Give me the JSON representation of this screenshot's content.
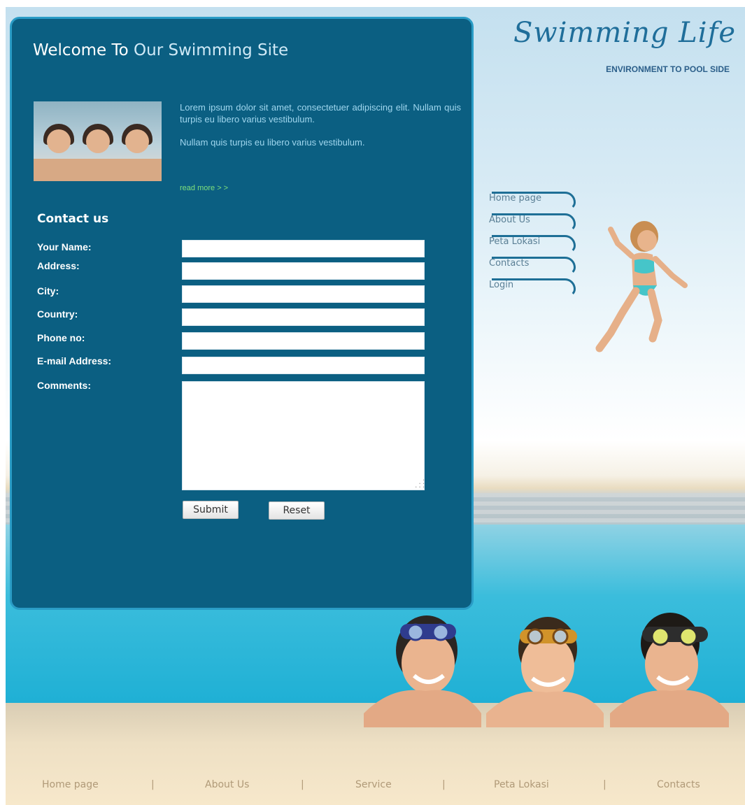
{
  "site": {
    "welcome_part1": "Welcome To ",
    "welcome_part2": "Our Swimming Site",
    "logo": "Swimming Life",
    "tagline": "ENVIRONMENT TO POOL SIDE"
  },
  "intro": {
    "paragraph1": "Lorem ipsum dolor sit amet, consectetuer adipiscing elit. Nullam quis turpis eu libero varius vestibulum.",
    "paragraph2": "Nullam quis turpis eu libero varius vestibulum.",
    "read_more": "read more > >"
  },
  "contact": {
    "title": "Contact us",
    "fields": {
      "name": {
        "label": "Your Name:",
        "value": ""
      },
      "address": {
        "label": "Address:",
        "value": ""
      },
      "city": {
        "label": "City:",
        "value": ""
      },
      "country": {
        "label": "Country:",
        "value": ""
      },
      "phone": {
        "label": "Phone no:",
        "value": ""
      },
      "email": {
        "label": "E-mail Address:",
        "value": ""
      },
      "comments": {
        "label": "Comments:",
        "value": ""
      }
    },
    "submit_label": "Submit",
    "reset_label": "Reset"
  },
  "side_nav": [
    "Home page",
    "About Us",
    "Peta Lokasi",
    "Contacts",
    "Login"
  ],
  "footer_nav": {
    "items": [
      "Home page",
      "About Us",
      "Service",
      "Peta Lokasi",
      "Contacts"
    ],
    "separator": "|"
  },
  "colors": {
    "panel": "#0b5f82",
    "panel_border": "#2a9cc6",
    "intro_text": "#9fd6ee",
    "read_more": "#7ee07c",
    "logo": "#1f6e9a",
    "footer_text": "#b09a78"
  },
  "icons": {
    "resize_grip": "resize-grip-icon"
  }
}
